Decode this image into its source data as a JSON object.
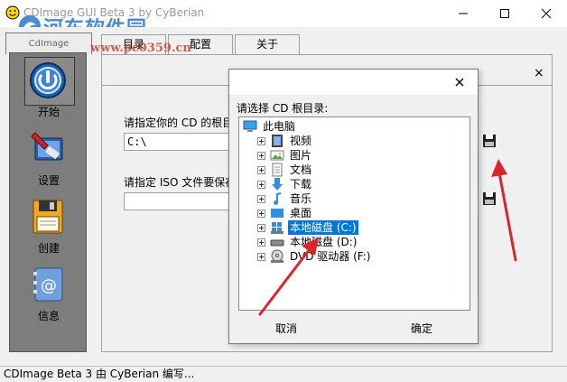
{
  "window": {
    "title": "CDImage GUI Beta 3 by CyBerian",
    "watermark_text": "河东软件园",
    "watermark_url": "www.pc0359.cn"
  },
  "tabs": {
    "main": "CdImage",
    "catalog": "目录",
    "config": "配置",
    "about": "关于"
  },
  "sidebar": {
    "start": "开始",
    "settings": "设置",
    "create": "创建",
    "info": "信息"
  },
  "main": {
    "close_glyph": "×",
    "cd_label": "请指定你的 CD 的根目",
    "cd_value": "C:\\",
    "iso_label": "请指定 ISO 文件要保存",
    "iso_value": ""
  },
  "dialog": {
    "prompt": "请选择 CD 根目录:",
    "root": "此电脑",
    "items": [
      "视频",
      "图片",
      "文档",
      "下载",
      "音乐",
      "桌面",
      "本地磁盘 (C:)",
      "本地磁盘 (D:)",
      "DVD 驱动器 (F:)"
    ],
    "selected": "本地磁盘 (C:)",
    "cancel": "取消",
    "ok": "确定"
  },
  "statusbar": {
    "text": "CDImage Beta 3 由 CyBerian 编写..."
  },
  "colors": {
    "selection": "#0078d7",
    "sidebar_bg": "#7d7d7d",
    "arrow": "#d9262b",
    "watermark_blue": "#2b77c8"
  }
}
